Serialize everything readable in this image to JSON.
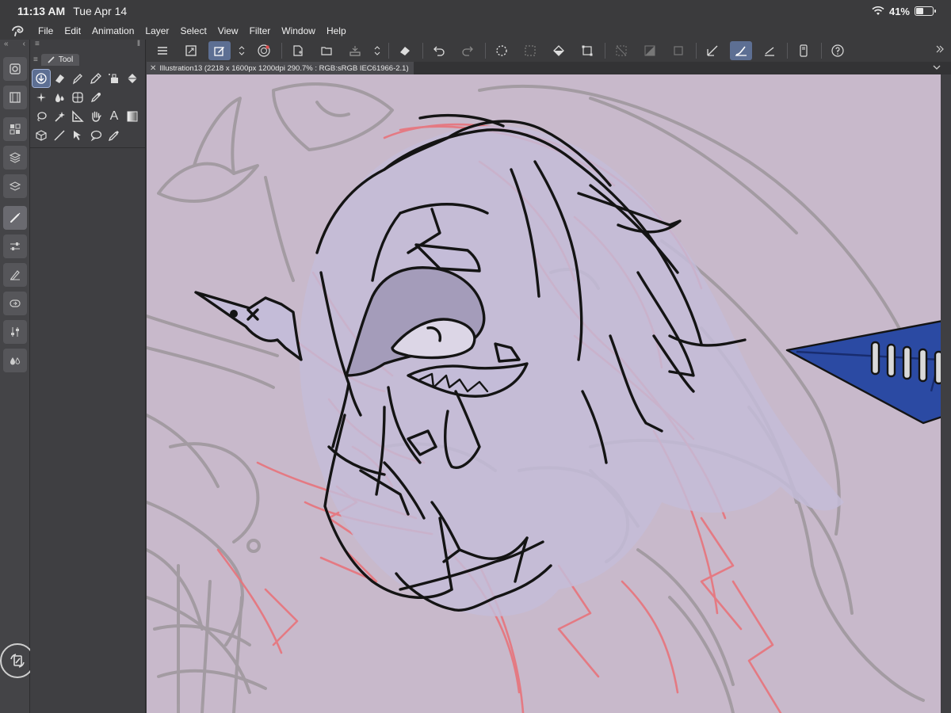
{
  "status_bar": {
    "time": "11:13 AM",
    "date": "Tue Apr 14",
    "battery_percent": "41%",
    "battery_level": 0.41,
    "icons": [
      "wifi-icon",
      "battery-icon"
    ]
  },
  "menu": {
    "items": [
      "File",
      "Edit",
      "Animation",
      "Layer",
      "Select",
      "View",
      "Filter",
      "Window",
      "Help"
    ]
  },
  "tool_panel": {
    "tab_label": "Tool",
    "tools": [
      "sub-view-tool-icon",
      "eraser-icon",
      "pen-icon",
      "pencil-icon",
      "airbrush-icon",
      "fill-icon",
      "sparkle-icon",
      "blend-icon",
      "mesh-grid-icon",
      "eyedropper-icon",
      "lasso-icon",
      "magic-wand-icon",
      "ruler-icon",
      "hand-icon",
      "text-icon",
      "gradient-icon",
      "3d-object-icon",
      "line-icon",
      "object-select-icon",
      "balloon-icon",
      "color-picker-icon"
    ]
  },
  "canvas_tab": {
    "title": "Illustration13 (2218 x 1600px 1200dpi 290.7% : RGB:sRGB IEC61966-2.1)"
  },
  "colors": {
    "canvas_bg": "#c8b9cb",
    "accent_active": "#5d6f93",
    "sketch_red": "#e8747c",
    "sketch_gray": "#9a9499",
    "lineart": "#141414"
  }
}
